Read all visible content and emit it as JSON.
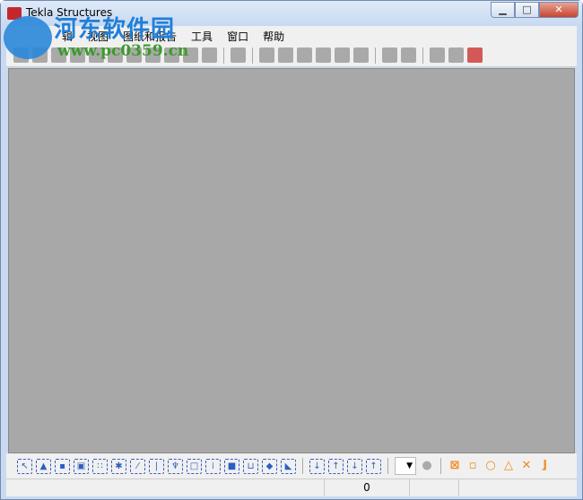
{
  "window": {
    "title": "Tekla Structures",
    "minimize": "▁",
    "maximize": "□",
    "close": "✕"
  },
  "menu": [
    "辑",
    "视图",
    "图纸和报告",
    "工具",
    "窗口",
    "帮助"
  ],
  "watermark": {
    "name": "河东软件园",
    "url": "www.pc0359.cn"
  },
  "status": {
    "value": "0"
  },
  "colors": {
    "canvas": "#a8a8a8",
    "accent": "#f08a1c"
  }
}
